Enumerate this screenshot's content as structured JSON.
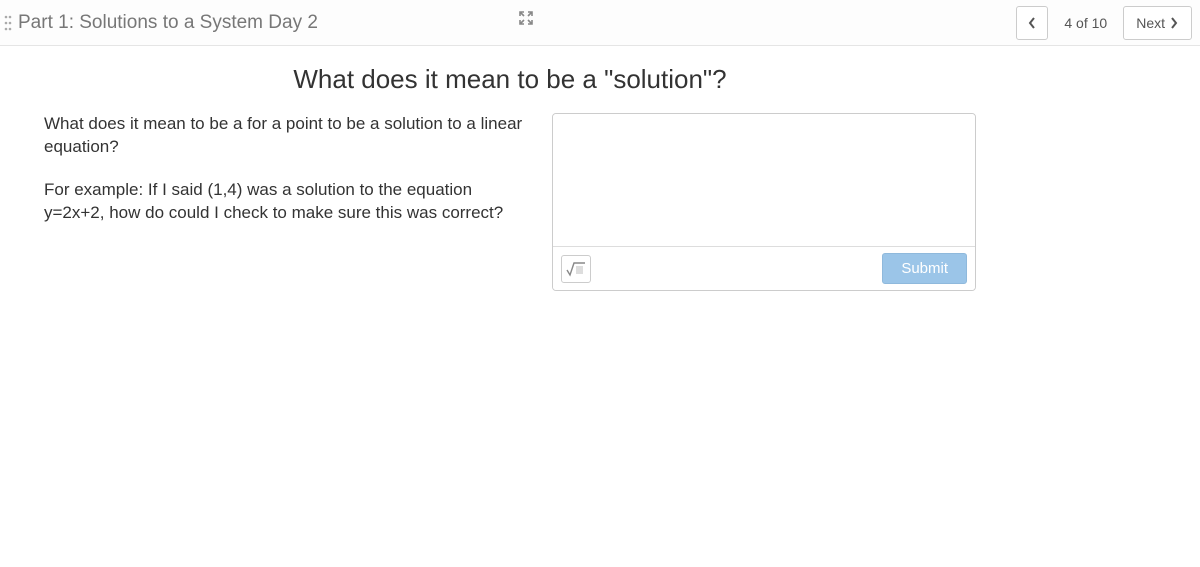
{
  "header": {
    "title": "Part 1: Solutions to a System Day 2",
    "page_indicator": "4 of 10",
    "next_label": "Next"
  },
  "question": {
    "heading": "What does it mean to be a \"solution\"?",
    "prompt_p1": "What does it mean to be a for a point to be a solution to a linear equation?",
    "prompt_p2": "For example: If I said (1,4) was a solution to the equation y=2x+2, how do could I check to make sure this was correct?"
  },
  "answer": {
    "value": "",
    "submit_label": "Submit"
  }
}
